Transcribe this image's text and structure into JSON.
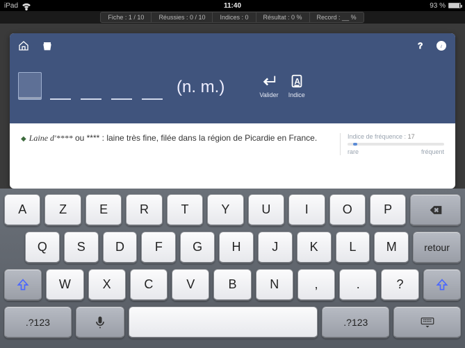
{
  "status": {
    "device": "iPad",
    "time": "11:40",
    "battery_pct": "93 %"
  },
  "scores": {
    "fiche": "Fiche : 1 / 10",
    "reussies": "Réussies : 0 / 10",
    "indices": "Indices : 0",
    "resultat": "Résultat : 0 %",
    "record": "Record : __ %"
  },
  "card": {
    "pos": "(n. m.)",
    "valider": "Valider",
    "indice": "Indice",
    "def_prefix": "Laine d'****",
    "def_middle": " ou ",
    "def_mask": "****",
    "def_rest": " : laine très fine, filée dans la région de Picardie en France.",
    "freq_title": "Indice de fréquence :",
    "freq_value": "17",
    "freq_rare": "rare",
    "freq_freq": "fréquent"
  },
  "kbd": {
    "r1": [
      "A",
      "Z",
      "E",
      "R",
      "T",
      "Y",
      "U",
      "I",
      "O",
      "P"
    ],
    "r2": [
      "Q",
      "S",
      "D",
      "F",
      "G",
      "H",
      "J",
      "K",
      "L",
      "M"
    ],
    "r3": [
      "W",
      "X",
      "C",
      "V",
      "B",
      "N",
      ",",
      ".",
      "?"
    ],
    "retour": "retour",
    "numkey": ".?123"
  }
}
